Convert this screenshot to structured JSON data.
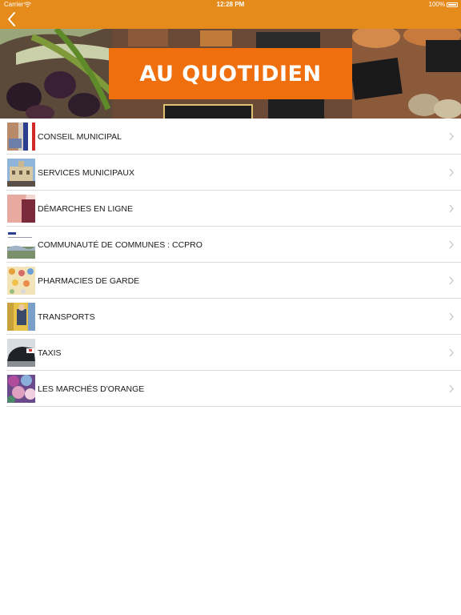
{
  "status": {
    "carrier": "Carrier",
    "time": "12:28 PM",
    "battery": "100%"
  },
  "nav": {
    "back_icon": "chevron-left-icon"
  },
  "banner": {
    "title": "AU QUOTIDIEN"
  },
  "colors": {
    "accent": "#e58b1c",
    "banner_box": "#ef6e0d"
  },
  "items": [
    {
      "label": "CONSEIL MUNICIPAL"
    },
    {
      "label": "SERVICES MUNICIPAUX"
    },
    {
      "label": "DÉMARCHES EN LIGNE"
    },
    {
      "label": "COMMUNAUTÉ DE COMMUNES : CCPRO"
    },
    {
      "label": "PHARMACIES DE GARDE"
    },
    {
      "label": "TRANSPORTS"
    },
    {
      "label": "TAXIS"
    },
    {
      "label": "LES MARCHÉS D'ORANGE"
    }
  ]
}
